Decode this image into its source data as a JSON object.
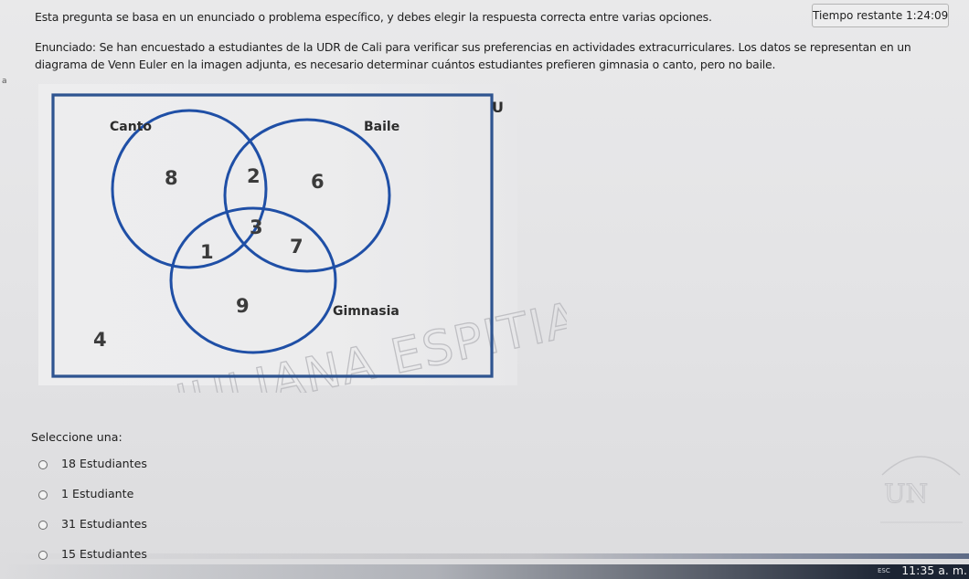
{
  "question": {
    "instruction": "Esta pregunta se basa en un enunciado o problema específico, y debes elegir la respuesta correcta entre varias opciones.",
    "enunciado": "Enunciado: Se han encuestado a estudiantes de la UDR de Cali para verificar sus preferencias en actividades extracurriculares. Los datos se representan en un diagrama de Venn Euler en la imagen adjunta, es necesario determinar cuántos estudiantes prefieren gimnasia o canto, pero no baile."
  },
  "timer": {
    "label": "Tiempo restante 1:24:09"
  },
  "stray_mark": "a",
  "venn": {
    "universe_label": "U",
    "sets": [
      "Canto",
      "Baile",
      "Gimnasia"
    ],
    "regions": {
      "canto_only": "8",
      "canto_baile": "2",
      "baile_only": "6",
      "all_three": "3",
      "canto_gimnasia": "1",
      "baile_gimnasia": "7",
      "gimnasia_only": "9",
      "outside": "4"
    },
    "watermark": "JULIANA ESPITIA GUTIERREZ",
    "circle_color": "#1f4fa6",
    "border_color": "#2e5490"
  },
  "answers": {
    "prompt": "Seleccione una:",
    "options": [
      {
        "label": "18 Estudiantes"
      },
      {
        "label": "1 Estudiante"
      },
      {
        "label": "31 Estudiantes"
      },
      {
        "label": "15 Estudiantes"
      }
    ]
  },
  "taskbar": {
    "clock": "11:35 a. m.",
    "key_hint": "ESC"
  }
}
